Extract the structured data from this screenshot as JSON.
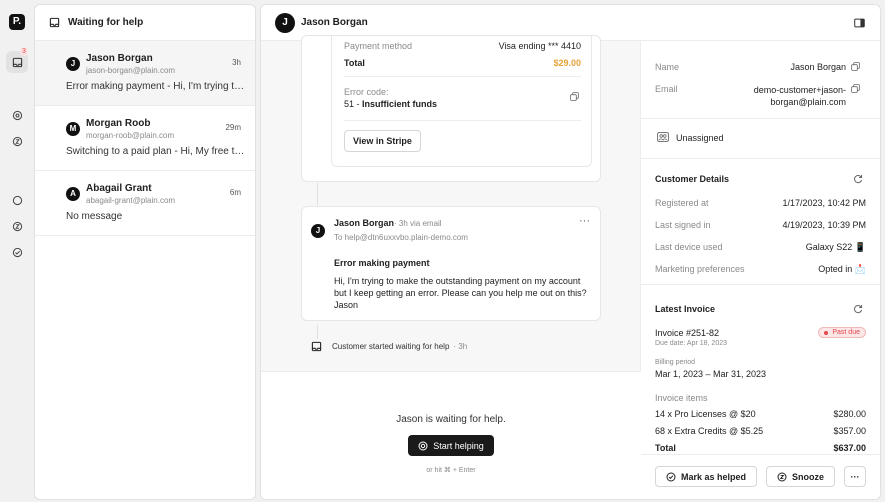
{
  "rail": {
    "logo": "P.",
    "badge": "3"
  },
  "list": {
    "title": "Waiting for help",
    "items": [
      {
        "initial": "J",
        "name": "Jason Borgan",
        "email": "jason-borgan@plain.com",
        "time": "3h",
        "message": "Error making payment - Hi, I'm trying to make the outstanding payment on my account"
      },
      {
        "initial": "M",
        "name": "Morgan Roob",
        "email": "morgan-roob@plain.com",
        "time": "29m",
        "message": "Switching to a paid plan - Hi, My free trial is ending soon"
      },
      {
        "initial": "A",
        "name": "Abagail Grant",
        "email": "abagail-grant@plain.com",
        "time": "6m",
        "message": "No message"
      }
    ]
  },
  "header": {
    "initial": "J",
    "title": "Jason Borgan"
  },
  "payment": {
    "method_label": "Payment method",
    "method_value": "Visa ending *** 4410",
    "total_label": "Total",
    "total_value": "$29.00",
    "error_label": "Error code:",
    "error_code": "51 - ",
    "error_text": "Insufficient funds",
    "stripe_button": "View in Stripe"
  },
  "email": {
    "initial": "J",
    "sender": "Jason Borgan",
    "meta": "· 3h via email",
    "to": "To help@dtn6uxxvbo.plain-demo.com",
    "subject": "Error making payment",
    "body": "Hi, I'm trying to make the outstanding payment on my account but I keep getting an error. Please can you help me out on this? Jason"
  },
  "event": {
    "text": "Customer started waiting for help",
    "ago": "· 3h"
  },
  "footer": {
    "waiting": "Jason is waiting for help.",
    "start_button": "Start helping",
    "hint": "or hit ⌘ + Enter"
  },
  "customer": {
    "name_label": "Name",
    "name_value": "Jason Borgan",
    "email_label": "Email",
    "email_line1": "demo-customer+jason-",
    "email_line2": "borgan@plain.com",
    "assignee": "Unassigned"
  },
  "details": {
    "title": "Customer Details",
    "rows": [
      {
        "label": "Registered at",
        "value": "1/17/2023, 10:42 PM"
      },
      {
        "label": "Last signed in",
        "value": "4/19/2023, 10:39 PM"
      },
      {
        "label": "Last device used",
        "value": "Galaxy S22 📱"
      },
      {
        "label": "Marketing preferences",
        "value": "Opted in 📩"
      }
    ]
  },
  "invoice": {
    "title": "Latest Invoice",
    "number": "Invoice #251-82",
    "due": "Due date: Apr 18, 2023",
    "status": "Past due",
    "period_label": "Billing period",
    "period": "Mar 1, 2023 – Mar 31, 2023",
    "items_label": "Invoice items",
    "items": [
      {
        "label": "14 x Pro Licenses @ $20",
        "value": "$280.00"
      },
      {
        "label": "68 x Extra Credits @ $5.25",
        "value": "$357.00"
      }
    ],
    "total_label": "Total",
    "total_value": "$637.00"
  },
  "actions": {
    "mark_helped": "Mark as helped",
    "snooze": "Snooze",
    "more": "···"
  },
  "colors": {
    "accent_orange": "#e8a33a",
    "danger": "#e5484d",
    "dark": "#1a1a1a"
  }
}
